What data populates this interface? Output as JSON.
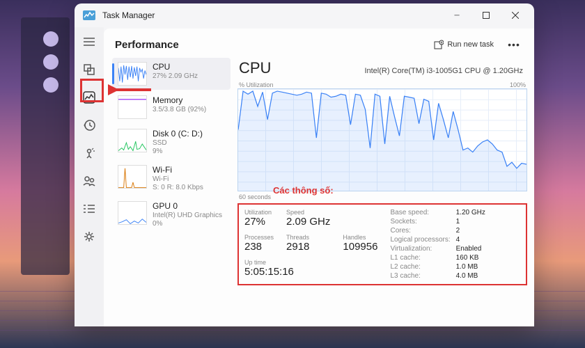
{
  "window": {
    "title": "Task Manager"
  },
  "header": {
    "title": "Performance",
    "run_task": "Run new task"
  },
  "sidebar": {
    "items": [
      {
        "name": "CPU",
        "sub": "27% 2.09 GHz",
        "color": "#3b82f6",
        "pattern": "cpu"
      },
      {
        "name": "Memory",
        "sub": "3.5/3.8 GB (92%)",
        "color": "#a855f7",
        "pattern": "mem"
      },
      {
        "name": "Disk 0 (C: D:)",
        "sub": "SSD\n9%",
        "color": "#22c55e",
        "pattern": "disk"
      },
      {
        "name": "Wi-Fi",
        "sub": "Wi-Fi\nS: 0 R: 8.0 Kbps",
        "color": "#d97706",
        "pattern": "wifi"
      },
      {
        "name": "GPU 0",
        "sub": "Intel(R) UHD Graphics\n0%",
        "color": "#3b82f6",
        "pattern": "gpu"
      }
    ]
  },
  "detail": {
    "title": "CPU",
    "model": "Intel(R) Core(TM) i3-1005G1 CPU @ 1.20GHz",
    "util_label": "% Utilization",
    "util_max": "100%",
    "time_label": "60 seconds",
    "stats_left": [
      {
        "lbl": "Utilization",
        "val": "27%"
      },
      {
        "lbl": "Speed",
        "val": "2.09 GHz"
      },
      {
        "lbl": "",
        "val": ""
      },
      {
        "lbl": "Processes",
        "val": "238"
      },
      {
        "lbl": "Threads",
        "val": "2918"
      },
      {
        "lbl": "Handles",
        "val": "109956"
      }
    ],
    "uptime": {
      "lbl": "Up time",
      "val": "5:05:15:16"
    },
    "stats_right": [
      {
        "k": "Base speed:",
        "v": "1.20 GHz"
      },
      {
        "k": "Sockets:",
        "v": "1"
      },
      {
        "k": "Cores:",
        "v": "2"
      },
      {
        "k": "Logical processors:",
        "v": "4"
      },
      {
        "k": "Virtualization:",
        "v": "Enabled"
      },
      {
        "k": "L1 cache:",
        "v": "160 KB"
      },
      {
        "k": "L2 cache:",
        "v": "1.0 MB"
      },
      {
        "k": "L3 cache:",
        "v": "4.0 MB"
      }
    ]
  },
  "annotations": {
    "stats_label": "Các thông số:"
  },
  "chart_data": {
    "type": "line",
    "title": "% Utilization",
    "xlabel": "60 seconds",
    "ylabel": "% Utilization",
    "ylim": [
      0,
      100
    ],
    "x": [
      0,
      1,
      2,
      3,
      4,
      5,
      6,
      7,
      8,
      9,
      10,
      11,
      12,
      13,
      14,
      15,
      16,
      17,
      18,
      19,
      20,
      21,
      22,
      23,
      24,
      25,
      26,
      27,
      28,
      29,
      30,
      31,
      32,
      33,
      34,
      35,
      36,
      37,
      38,
      39,
      40,
      41,
      42,
      43,
      44,
      45,
      46,
      47,
      48,
      49,
      50,
      51,
      52,
      53,
      54,
      55,
      56,
      57,
      58,
      59
    ],
    "values": [
      60,
      98,
      95,
      98,
      83,
      97,
      70,
      96,
      98,
      97,
      96,
      95,
      94,
      95,
      97,
      96,
      52,
      96,
      95,
      92,
      93,
      95,
      94,
      65,
      95,
      94,
      80,
      42,
      95,
      93,
      46,
      93,
      73,
      54,
      93,
      92,
      91,
      66,
      90,
      88,
      50,
      86,
      70,
      52,
      78,
      60,
      40,
      42,
      38,
      44,
      48,
      50,
      46,
      40,
      38,
      24,
      28,
      22,
      27,
      26
    ]
  }
}
